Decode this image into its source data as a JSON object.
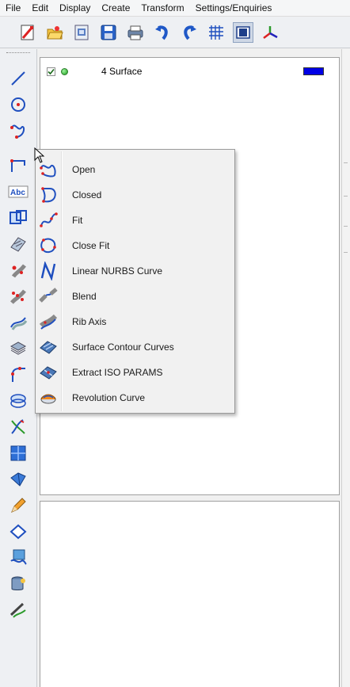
{
  "menubar": {
    "items": [
      "File",
      "Edit",
      "Display",
      "Create",
      "Transform",
      "Settings/Enquiries"
    ]
  },
  "toolbar": {
    "icons": [
      "new-icon",
      "open-folder-icon",
      "model-icon",
      "save-icon",
      "print-icon",
      "undo-icon",
      "redo-icon",
      "grid-icon",
      "view-mode-icon",
      "axis-icon"
    ]
  },
  "left_toolbar": {
    "icons": [
      "line-icon",
      "circle-icon",
      "curve-icon",
      "dimension-icon",
      "text-icon",
      "view-icon",
      "surface-icon",
      "point-icon",
      "point-array-icon",
      "offset-icon",
      "stack-icon",
      "fillet-icon",
      "intersect-icon",
      "trim-icon",
      "plane-icon",
      "solid-icon",
      "pencil-icon",
      "box-icon",
      "mesh-icon",
      "database-icon",
      "sketch-icon"
    ]
  },
  "tree": {
    "row": {
      "checked": true,
      "label": "4  Surface",
      "color": "#0000e6"
    }
  },
  "context_menu": {
    "items": [
      {
        "label": "Open",
        "icon": "open-curve-icon"
      },
      {
        "label": "Closed",
        "icon": "closed-curve-icon"
      },
      {
        "label": "Fit",
        "icon": "fit-curve-icon"
      },
      {
        "label": "Close Fit",
        "icon": "close-fit-curve-icon"
      },
      {
        "label": "Linear NURBS Curve",
        "icon": "nurbs-icon"
      },
      {
        "label": "Blend",
        "icon": "blend-icon"
      },
      {
        "label": "Rib Axis",
        "icon": "rib-axis-icon"
      },
      {
        "label": "Surface Contour Curves",
        "icon": "surface-contour-icon"
      },
      {
        "label": "Extract ISO PARAMS",
        "icon": "extract-iso-icon"
      },
      {
        "label": "Revolution Curve",
        "icon": "revolution-curve-icon"
      }
    ]
  }
}
